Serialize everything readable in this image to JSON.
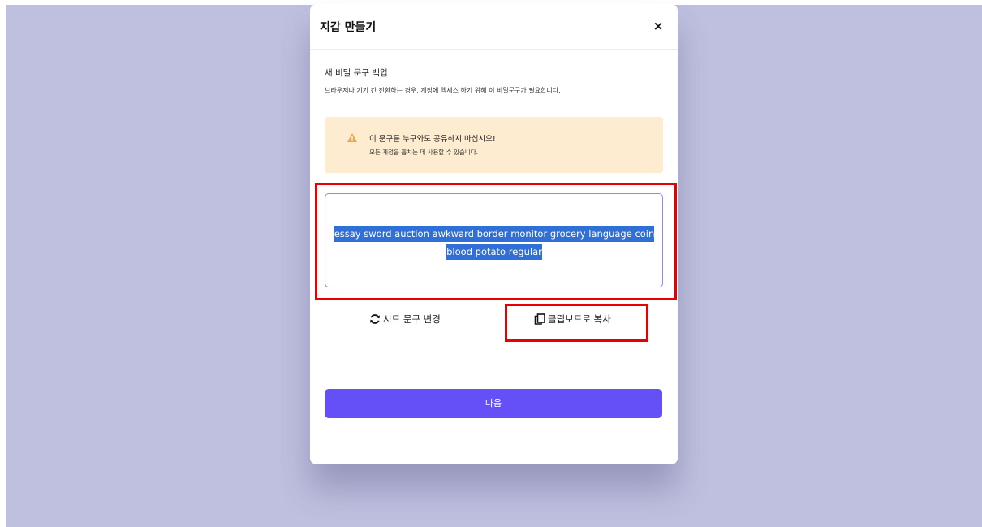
{
  "modal": {
    "title": "지갑 만들기",
    "close_label": "×",
    "section_title": "새 비밀 문구 백업",
    "section_description": "브라우저나 기기 간 전환하는 경우, 계정에 액세스 하기 위해 이 비밀문구가 필요합니다.",
    "warning": {
      "title": "이 문구를 누구와도 공유하지 마십시오!",
      "subtitle": "모든 계정을 훔치는 데 사용할 수 있습니다.",
      "icon": "warning-triangle-icon",
      "color": "#f5a34a",
      "background": "#fdecd0"
    },
    "seed_phrase": "essay sword auction awkward border monitor grocery language coin blood potato regular",
    "actions": {
      "refresh_label": "시드 문구 변경",
      "refresh_icon": "refresh-icon",
      "copy_label": "클립보드로 복사",
      "copy_icon": "copy-icon"
    },
    "next_label": "다음"
  },
  "colors": {
    "overlay": "#bfc0df",
    "primary": "#654ff6",
    "selection": "#2f6fd6",
    "seed_border": "#8e8ae8",
    "annotation_highlight": "#e60000"
  }
}
